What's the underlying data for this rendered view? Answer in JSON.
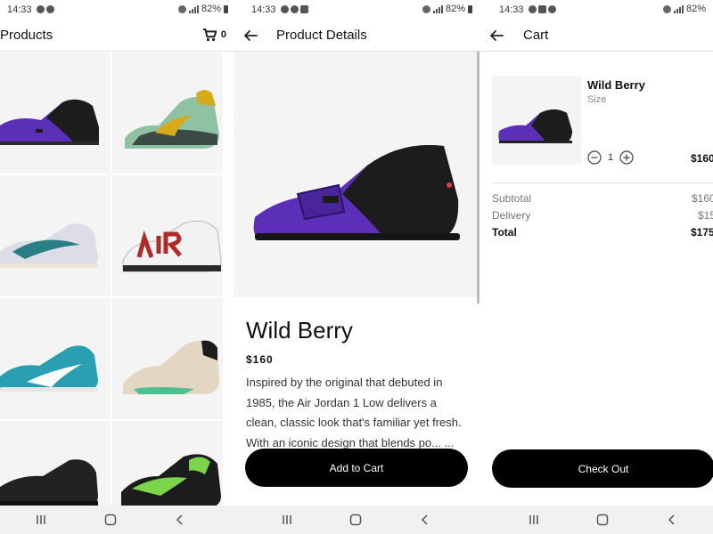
{
  "status_bar": {
    "time": "14:33",
    "battery": "82%"
  },
  "products_screen": {
    "title": "Products",
    "cart_count": "0",
    "products": [
      {
        "icon": "purple-black-sneaker-icon"
      },
      {
        "icon": "green-yellow-sneaker-icon"
      },
      {
        "icon": "white-teal-running-shoe-icon"
      },
      {
        "icon": "white-red-air-sneaker-icon"
      },
      {
        "icon": "blue-running-shoe-icon"
      },
      {
        "icon": "beige-basketball-shoe-icon"
      },
      {
        "icon": "black-running-shoe-icon"
      },
      {
        "icon": "black-green-sneaker-icon"
      }
    ]
  },
  "details_screen": {
    "title": "Product Details",
    "product_name": "Wild Berry",
    "price": "$160",
    "description": "Inspired by the original that debuted in 1985, the Air Jordan 1 Low delivers a clean, classic look that's familiar yet fresh. With an iconic design that blends po... ... ...",
    "add_to_cart_label": "Add to Cart"
  },
  "cart_screen": {
    "title": "Cart",
    "item": {
      "name": "Wild Berry",
      "size_label": "Size",
      "quantity": "1",
      "price": "$160"
    },
    "summary": {
      "subtotal_label": "Subtotal",
      "subtotal_value": "$160",
      "delivery_label": "Delivery",
      "delivery_value": "$15",
      "total_label": "Total",
      "total_value": "$175"
    },
    "checkout_label": "Check Out"
  },
  "colors": {
    "accent": "#000000",
    "placeholder_bg": "#f4f4f4",
    "shoe_purple": "#5b2fb8",
    "shoe_black": "#1c1c1c",
    "shoe_green": "#8fc1a3",
    "shoe_teal": "#2a9fb1",
    "shoe_beige": "#e3d6c3"
  }
}
